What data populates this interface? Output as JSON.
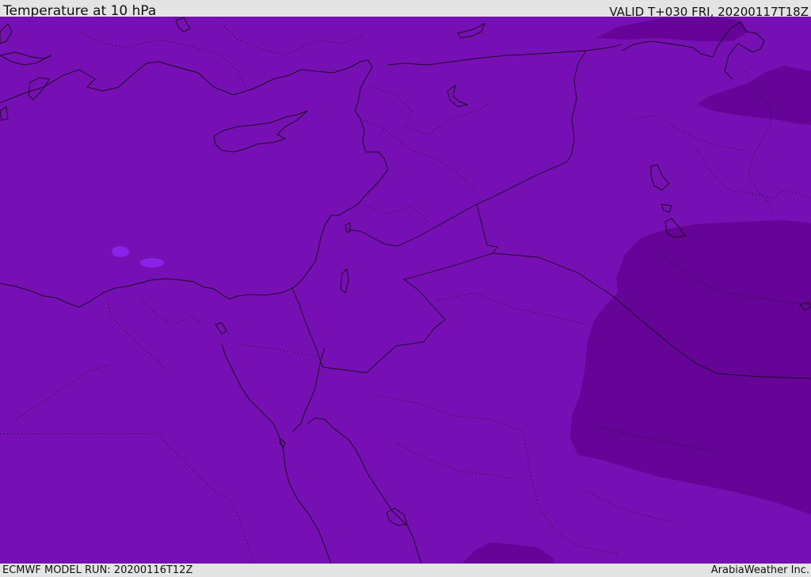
{
  "header": {
    "title": "Temperature at 10 hPa",
    "valid_time": "VALID T+030 FRI, 20200117T18Z"
  },
  "footer": {
    "model_run": "ECMWF MODEL RUN: 20200116T12Z",
    "credit": "ArabiaWeather Inc."
  },
  "colors": {
    "base_field": "#7710b4",
    "cold_field": "#650496",
    "warm_spot": "#8a22e8",
    "coastline": "#1a0b22",
    "border_dotted": "#2c0840"
  }
}
